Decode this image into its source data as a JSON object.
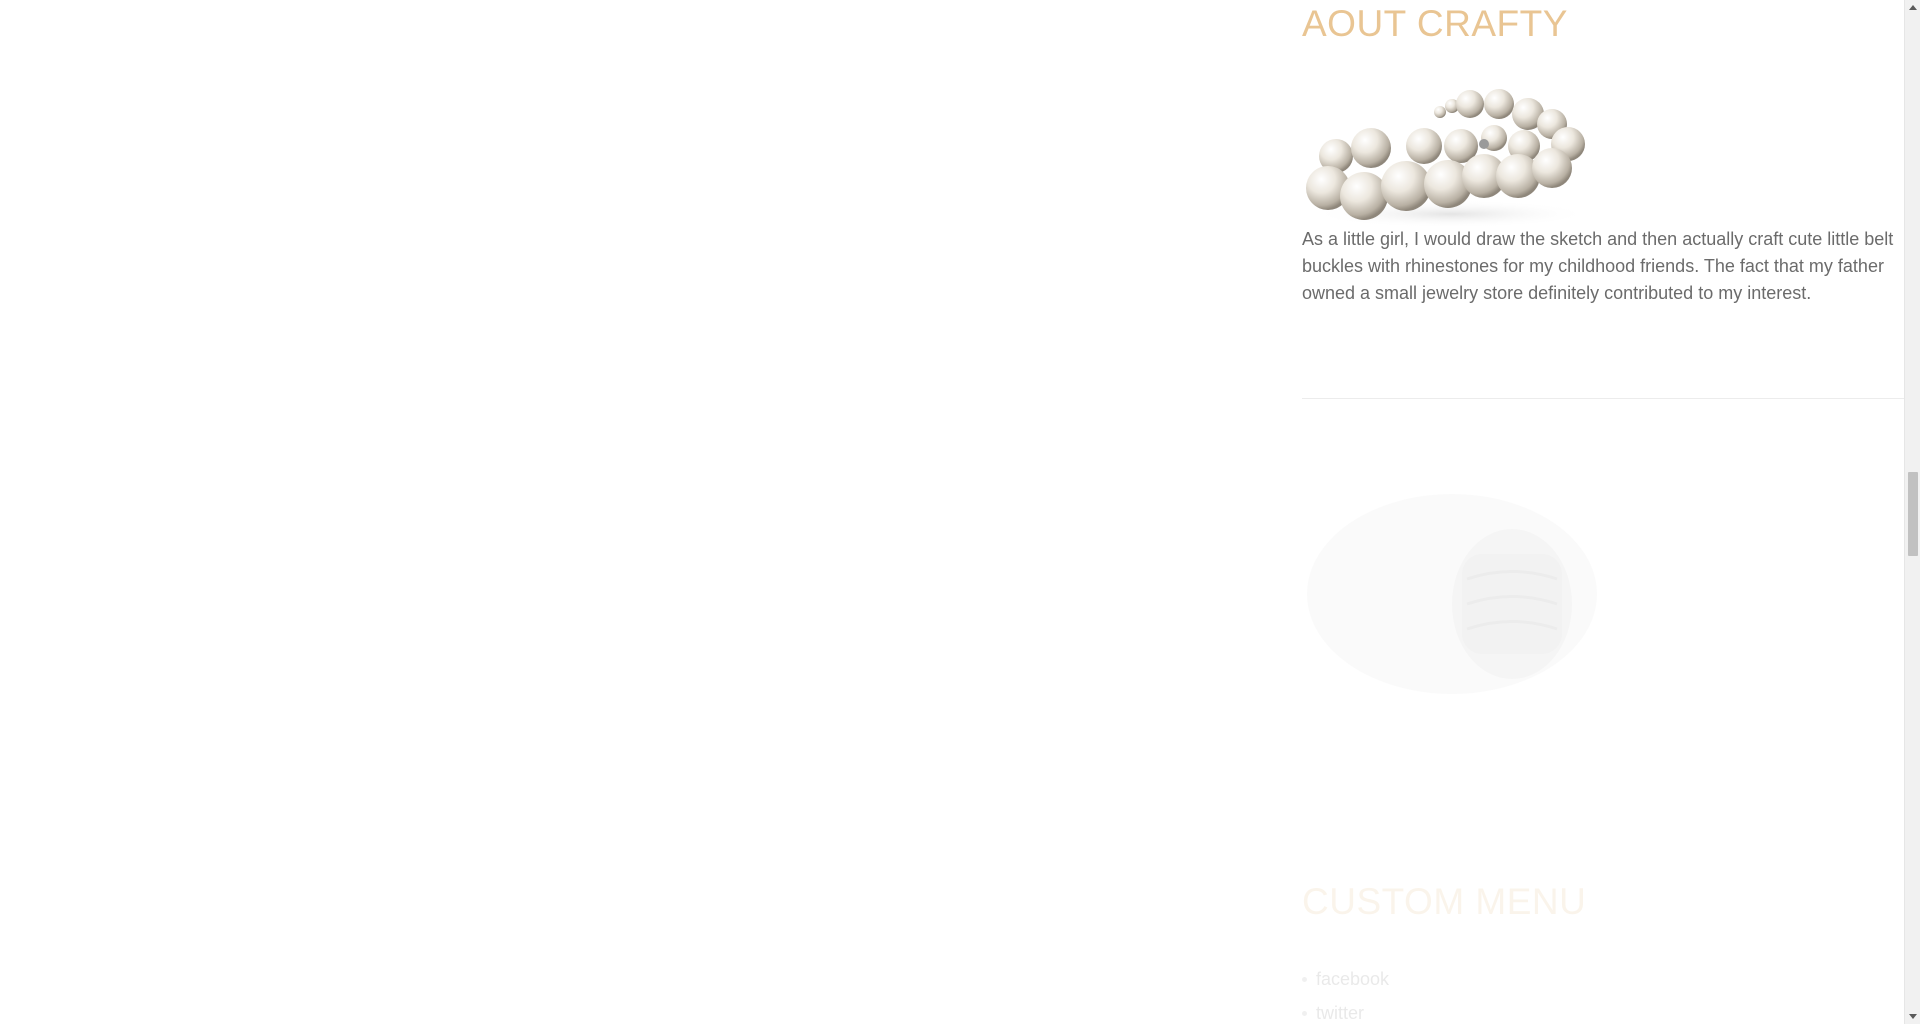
{
  "about": {
    "title": "AOUT CRAFTY",
    "image": "pearl-bracelet-image",
    "text": "As a little girl, I would draw the sketch and then actually craft cute little belt buckles with rhinestones for my childhood friends. The fact that my father owned a small jewelry store definitely contributed to my interest."
  },
  "featured": {
    "image": "silver-cuff-bracelet-image"
  },
  "custom_menu": {
    "title": "CUSTOM MENU",
    "items": [
      {
        "label": "facebook"
      },
      {
        "label": "twitter"
      }
    ]
  },
  "colors": {
    "heading": "#e9c593",
    "body_text": "#6b6b6b",
    "divider": "#ececec"
  }
}
